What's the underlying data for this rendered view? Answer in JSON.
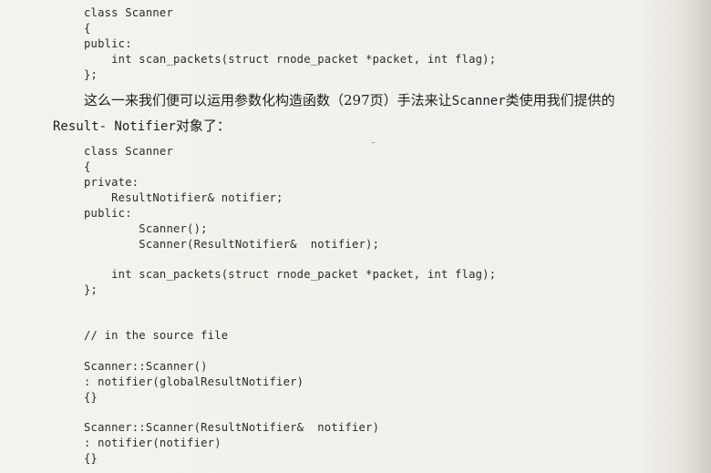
{
  "code_block_1": {
    "lines": [
      "class Scanner",
      "{",
      "public:",
      "    int scan_packets(struct rnode_packet *packet, int flag);",
      "};"
    ]
  },
  "paragraph": {
    "line1_prefix": "这么一来我们便可以运用参数化构造函数（297页）手法来让",
    "line1_code": "Scanner",
    "line1_suffix": "类使用我们提供的",
    "line2_code": "Result- Notifier",
    "line2_suffix": "对象了："
  },
  "code_block_2": {
    "lines": [
      "class Scanner",
      "{",
      "private:",
      "    ResultNotifier& notifier;",
      "public:",
      "        Scanner();",
      "        Scanner(ResultNotifier&  notifier);",
      "",
      "    int scan_packets(struct rnode_packet *packet, int flag);",
      "};",
      "",
      "",
      "// in the source file",
      "",
      "Scanner::Scanner()",
      ": notifier(globalResultNotifier)",
      "{}",
      "",
      "Scanner::Scanner(ResultNotifier&  notifier)",
      ": notifier(notifier)",
      "{}"
    ]
  }
}
